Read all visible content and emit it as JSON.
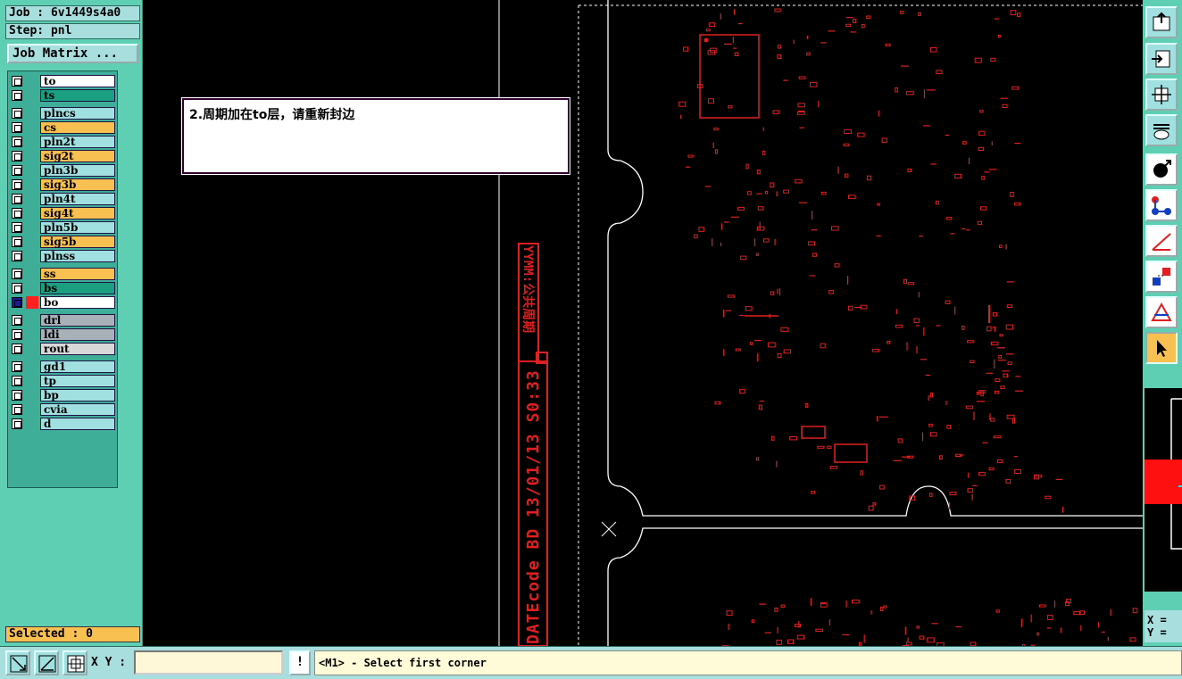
{
  "header": {
    "job_label": "Job : 6v1449s4a0",
    "step_label": "Step: pnl",
    "job_matrix_button": "Job Matrix ..."
  },
  "layers": [
    {
      "name": "to",
      "color": "#ffffff"
    },
    {
      "name": "ts",
      "color": "#1aa080"
    },
    {
      "name": "plncs",
      "color": "#a0e0e0"
    },
    {
      "name": "cs",
      "color": "#f8c050"
    },
    {
      "name": "pln2t",
      "color": "#a0e0e0"
    },
    {
      "name": "sig2t",
      "color": "#f8c050"
    },
    {
      "name": "pln3b",
      "color": "#a0e0e0"
    },
    {
      "name": "sig3b",
      "color": "#f8c050"
    },
    {
      "name": "pln4t",
      "color": "#a0e0e0"
    },
    {
      "name": "sig4t",
      "color": "#f8c050"
    },
    {
      "name": "pln5b",
      "color": "#a0e0e0"
    },
    {
      "name": "sig5b",
      "color": "#f8c050"
    },
    {
      "name": "plnss",
      "color": "#a0e0e0"
    },
    {
      "name": "ss",
      "color": "#f8c050"
    },
    {
      "name": "bs",
      "color": "#1aa080"
    },
    {
      "name": "bo",
      "color": "#ffffff",
      "active": true
    },
    {
      "name": "drl",
      "color": "#a8b0b8"
    },
    {
      "name": "ldi",
      "color": "#a8b0b8"
    },
    {
      "name": "rout",
      "color": "#d8d8d8"
    },
    {
      "name": "gd1",
      "color": "#a0e0e0"
    },
    {
      "name": "tp",
      "color": "#a0e0e0"
    },
    {
      "name": "bp",
      "color": "#a0e0e0"
    },
    {
      "name": "cvia",
      "color": "#a0e0e0"
    },
    {
      "name": "d",
      "color": "#a0e0e0"
    }
  ],
  "selected_label": "Selected : 0",
  "note": {
    "text": "2.周期加在to层，请重新封边"
  },
  "board": {
    "vertical_text_top": "YYMM:公共周期",
    "vertical_text_bottom": "DATEcode BD 13/01/13 S0:33"
  },
  "coord_readout": {
    "x_label": "X =",
    "y_label": "Y ="
  },
  "bottom": {
    "xy_label": "X Y :",
    "xy_value": "",
    "info_button": "!",
    "status": "<M1> - Select first corner"
  },
  "colors": {
    "panel_bg": "#5fcfb4",
    "board_red": "#e02020",
    "outline_white": "#ffffff"
  }
}
